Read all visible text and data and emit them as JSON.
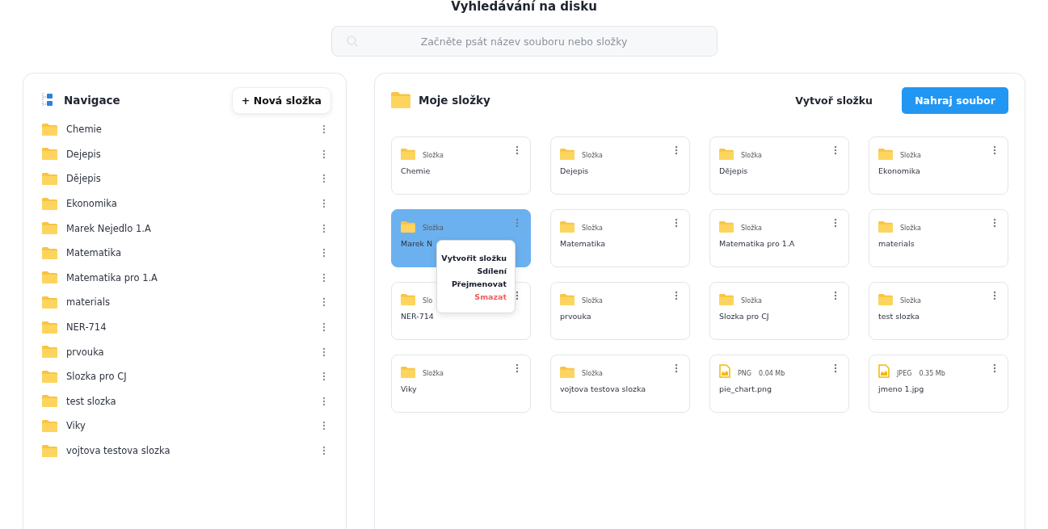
{
  "page_title": "Vyhledávání na disku",
  "search": {
    "placeholder": "Začněte psát název souboru nebo složky"
  },
  "sidebar": {
    "title": "Navigace",
    "new_folder_button": "+ Nová složka",
    "items": [
      {
        "label": "Chemie"
      },
      {
        "label": "Dejepis"
      },
      {
        "label": "Dějepis"
      },
      {
        "label": "Ekonomika"
      },
      {
        "label": "Marek Nejedlo 1.A"
      },
      {
        "label": "Matematika"
      },
      {
        "label": "Matematika pro 1.A"
      },
      {
        "label": "materials"
      },
      {
        "label": "NER-714"
      },
      {
        "label": "prvouka"
      },
      {
        "label": "Slozka pro CJ"
      },
      {
        "label": "test slozka"
      },
      {
        "label": "Viky"
      },
      {
        "label": "vojtova testova slozka"
      }
    ]
  },
  "main": {
    "title": "Moje složky",
    "create_folder_button": "Vytvoř složku",
    "upload_button": "Nahraj soubor",
    "items": [
      {
        "kind": "folder",
        "type": "Složka",
        "name": "Chemie",
        "selected": false
      },
      {
        "kind": "folder",
        "type": "Složka",
        "name": "Dejepis",
        "selected": false
      },
      {
        "kind": "folder",
        "type": "Složka",
        "name": "Dějepis",
        "selected": false
      },
      {
        "kind": "folder",
        "type": "Složka",
        "name": "Ekonomika",
        "selected": false
      },
      {
        "kind": "folder",
        "type": "Složka",
        "name": "Marek N",
        "selected": true,
        "menu": [
          {
            "label": "Vytvořit složku",
            "kind": "normal"
          },
          {
            "label": "Sdílení",
            "kind": "normal"
          },
          {
            "label": "Přejmenovat",
            "kind": "normal"
          },
          {
            "label": "Smazat",
            "kind": "danger"
          }
        ]
      },
      {
        "kind": "folder",
        "type": "Složka",
        "name": "Matematika",
        "selected": false
      },
      {
        "kind": "folder",
        "type": "Složka",
        "name": "Matematika pro 1.A",
        "selected": false
      },
      {
        "kind": "folder",
        "type": "Složka",
        "name": "materials",
        "selected": false
      },
      {
        "kind": "folder",
        "type": "Slo",
        "name": "NER-714",
        "selected": false
      },
      {
        "kind": "folder",
        "type": "Složka",
        "name": "prvouka",
        "selected": false
      },
      {
        "kind": "folder",
        "type": "Složka",
        "name": "Slozka pro CJ",
        "selected": false
      },
      {
        "kind": "folder",
        "type": "Složka",
        "name": "test slozka",
        "selected": false
      },
      {
        "kind": "folder",
        "type": "Složka",
        "name": "Viky",
        "selected": false
      },
      {
        "kind": "folder",
        "type": "Složka",
        "name": "vojtova testova slozka",
        "selected": false
      },
      {
        "kind": "file",
        "type": "PNG",
        "size": "0.04 Mb",
        "name": "pie_chart.png",
        "selected": false
      },
      {
        "kind": "file",
        "type": "JPEG",
        "size": "0.35 Mb",
        "name": "jmeno 1.jpg",
        "selected": false
      }
    ]
  }
}
